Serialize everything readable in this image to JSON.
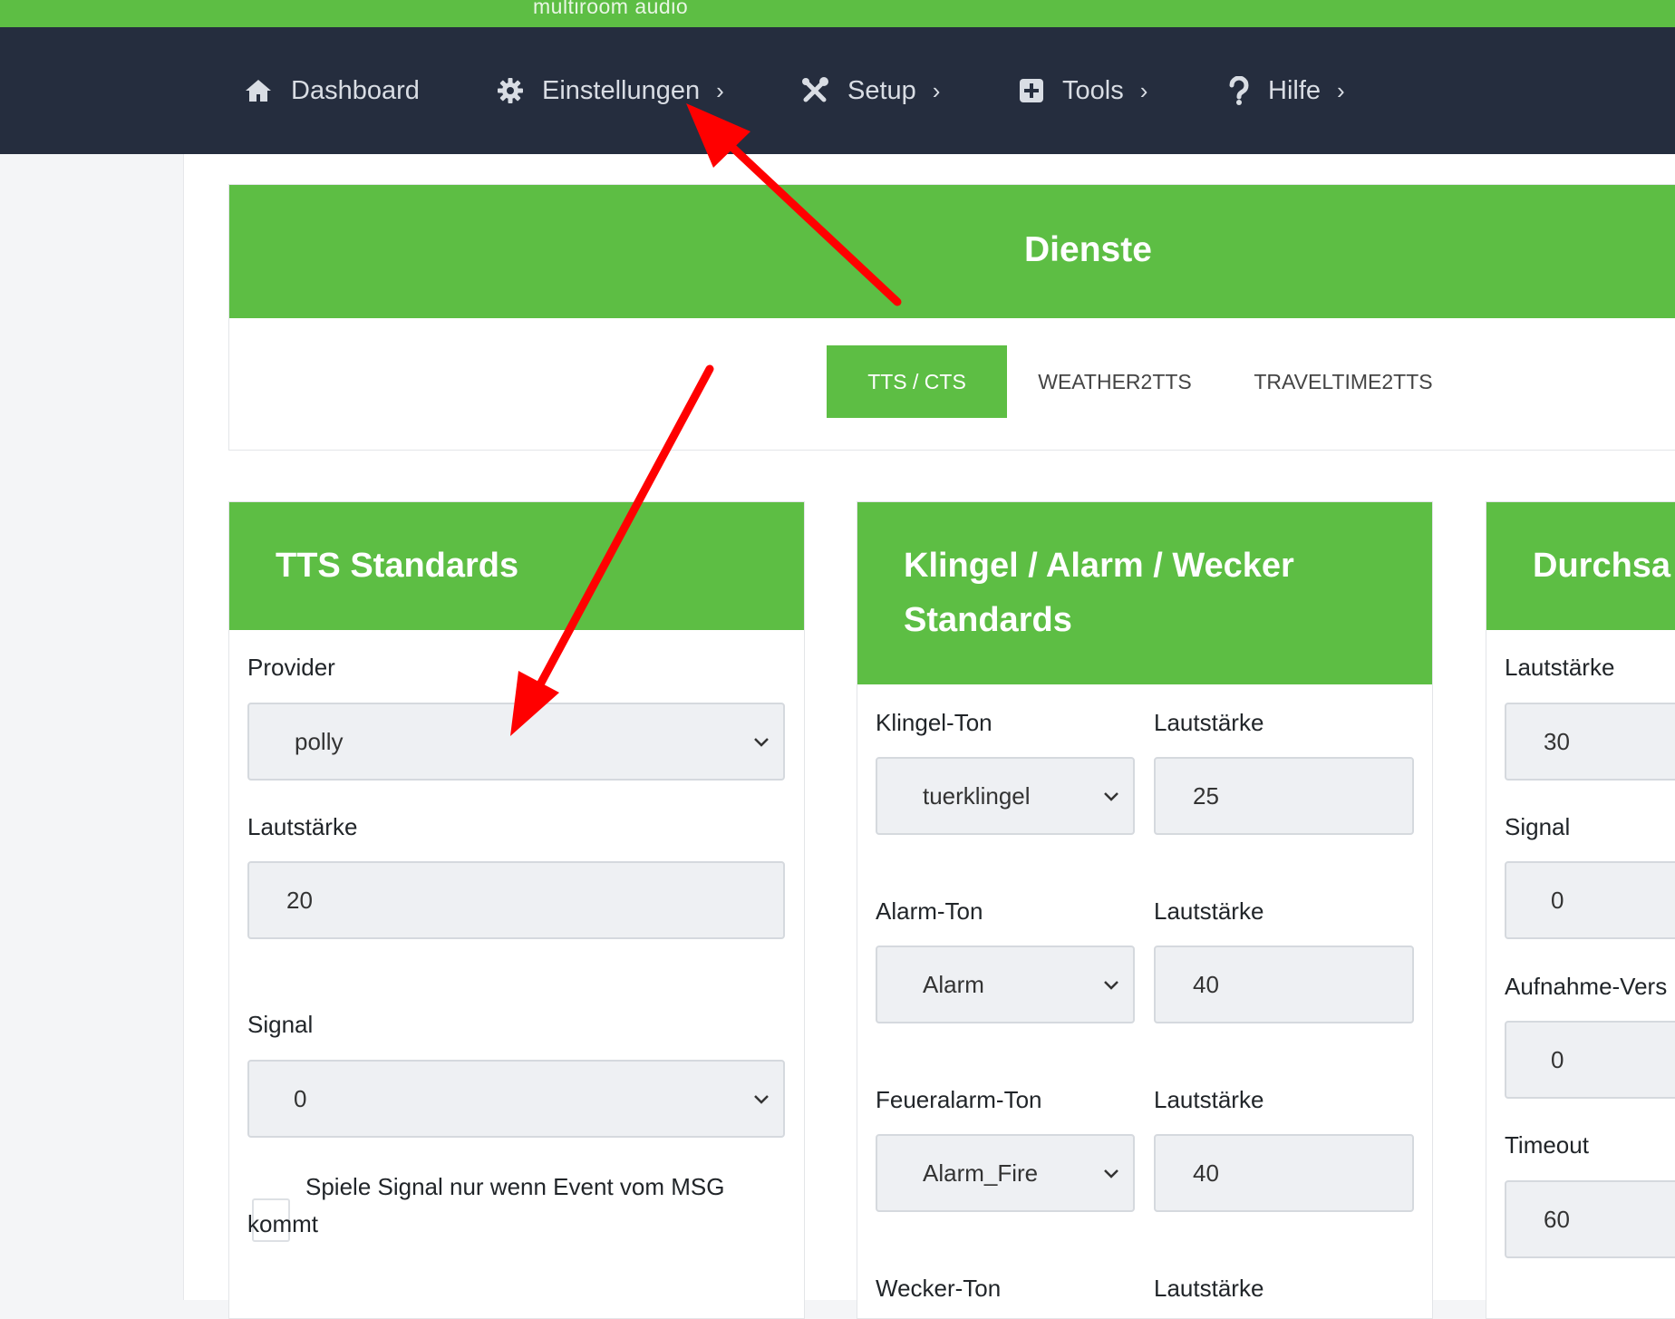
{
  "brand": "multiroom audio",
  "nav": [
    {
      "label": "Dashboard",
      "icon": "home-icon",
      "chevron": ""
    },
    {
      "label": "Einstellungen",
      "icon": "gear-icon",
      "chevron": "›"
    },
    {
      "label": "Setup",
      "icon": "tools-icon",
      "chevron": "›"
    },
    {
      "label": "Tools",
      "icon": "plus-square-icon",
      "chevron": "›"
    },
    {
      "label": "Hilfe",
      "icon": "question-icon",
      "chevron": "›"
    }
  ],
  "section_title": "Dienste",
  "tabs": [
    "TTS / CTS",
    "WEATHER2TTS",
    "TRAVELTIME2TTS"
  ],
  "tts_card": {
    "title": "TTS Standards",
    "provider_label": "Provider",
    "provider_value": "polly",
    "volume_label": "Lautstärke",
    "volume_value": "20",
    "signal_label": "Signal",
    "signal_value": "0",
    "checkbox_line1": "Spiele Signal nur wenn Event vom MSG",
    "checkbox_line2": "kommt"
  },
  "alarm_card": {
    "title_line1": "Klingel / Alarm / Wecker",
    "title_line2": "Standards",
    "rows": [
      {
        "tone_label": "Klingel-Ton",
        "tone_value": "tuerklingel",
        "volume_label": "Lautstärke",
        "volume_value": "25"
      },
      {
        "tone_label": "Alarm-Ton",
        "tone_value": "Alarm",
        "volume_label": "Lautstärke",
        "volume_value": "40"
      },
      {
        "tone_label": "Feueralarm-Ton",
        "tone_value": "Alarm_Fire",
        "volume_label": "Lautstärke",
        "volume_value": "40"
      },
      {
        "tone_label": "Wecker-Ton",
        "volume_label": "Lautstärke"
      }
    ]
  },
  "broadcast_card": {
    "title": "Durchsa",
    "volume_label": "Lautstärke",
    "volume_value": "30",
    "signal_label": "Signal",
    "signal_value": "0",
    "recording_label": "Aufnahme-Vers",
    "recording_value": "0",
    "timeout_label": "Timeout",
    "timeout_value": "60"
  },
  "colors": {
    "accent": "#5dbe44",
    "navbar": "#252d3e",
    "annotation": "#ff0000"
  }
}
